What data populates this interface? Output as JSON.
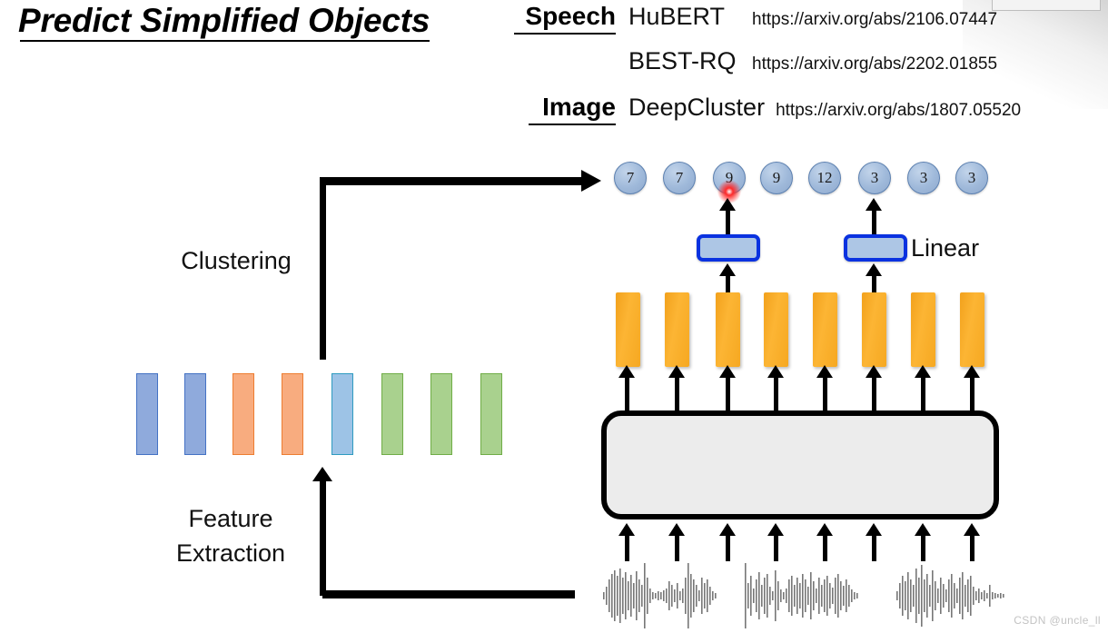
{
  "title": {
    "text": "Predict Simplified Objects"
  },
  "references": [
    {
      "domain": "Speech",
      "model": "HuBERT",
      "url": "https://arxiv.org/abs/2106.07447"
    },
    {
      "domain": "",
      "model": "BEST-RQ",
      "url": "https://arxiv.org/abs/2202.01855"
    },
    {
      "domain": "Image",
      "model": "DeepCluster",
      "url": "https://arxiv.org/abs/1807.05520"
    }
  ],
  "diagram": {
    "cluster_tokens": [
      "7",
      "7",
      "9",
      "9",
      "12",
      "3",
      "3",
      "3"
    ],
    "linear_label": "Linear",
    "stage_labels": {
      "clustering": "Clustering",
      "feature_extraction": "Feature\nExtraction"
    },
    "feature_bars": [
      {
        "fill": "#8FAADC",
        "stroke": "#4472C4"
      },
      {
        "fill": "#8FAADC",
        "stroke": "#4472C4"
      },
      {
        "fill": "#F8AC7F",
        "stroke": "#ED7D31"
      },
      {
        "fill": "#F8AC7F",
        "stroke": "#ED7D31"
      },
      {
        "fill": "#9DC3E6",
        "stroke": "#2E9BC0"
      },
      {
        "fill": "#A9D18E",
        "stroke": "#70AD47"
      },
      {
        "fill": "#A9D18E",
        "stroke": "#70AD47"
      },
      {
        "fill": "#A9D18E",
        "stroke": "#70AD47"
      }
    ],
    "colors": {
      "token_circle_fill": "#9FB9DA",
      "token_circle_border": "#5C80B0",
      "linear_box_fill": "#ADC6E5",
      "linear_box_border": "#0A32E0",
      "hidden_bar": "#FAB132",
      "encoder_fill": "#ECECEC",
      "encoder_border": "#000000",
      "laser_pointer": "#FF2A2A",
      "waveform": "#5A5A5A"
    },
    "hidden_bar_count": 8,
    "encoder_input_arrow_count": 8,
    "linear_head_count": 2,
    "waveform_count": 3
  },
  "watermark": {
    "text": "CSDN @uncle_ll"
  }
}
